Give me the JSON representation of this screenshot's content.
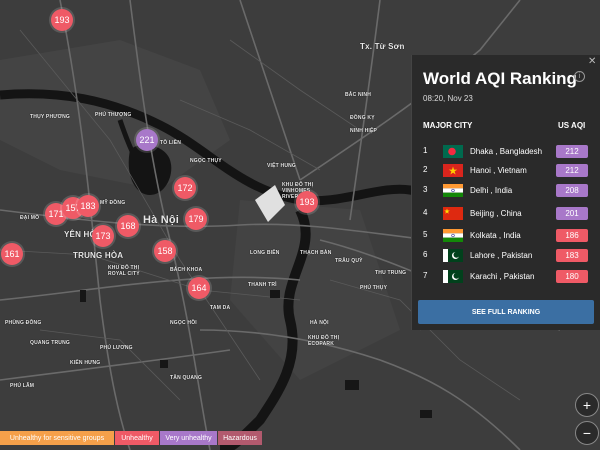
{
  "map": {
    "labels": {
      "hanoi": "Hà Nội",
      "yen_hoa": "YÊN HÒA",
      "trung_hoa": "TRUNG HÒA",
      "tx_tu_son": "Tx. Từ Sơn",
      "bac_ninh": "BẮC NINH",
      "thuy_phuong": "THỤY PHƯƠNG",
      "phu_thuong": "PHÚ THƯỢNG",
      "to_lien": "TÔ LIỀN",
      "ngoc_thuy": "NGỌC THỤY",
      "viet_hung": "VIỆT HUNG",
      "khu_do_thi_vinhomes": "KHU ĐÔ THỊ VINHOMES RIVERSIDE",
      "khu_do_thi_royal": "KHU ĐÔ THỊ ROYAL CITY",
      "bach_khoa": "BÁCH KHOA",
      "thanh_tri": "THANH TRÌ",
      "ha_noi_small": "HÀ NỘI",
      "khu_do_thi_ecopark": "KHU ĐÔ THỊ ECOPARK",
      "phung_dong": "PHÙNG ĐÔNG",
      "quang_trung": "QUANG TRUNG",
      "dai_mo": "ĐẠI MỖ",
      "kien_hung": "KIẾN HƯNG",
      "phu_lam": "PHÚ LÃM",
      "phu_luong": "PHÚ LƯƠNG",
      "tan_quang": "TÂN QUANG",
      "my_dong": "MỸ ĐỒNG",
      "long_bien": "LONG BIÊN",
      "tam_da": "TAM DA",
      "ngoc_hoi": "NGỌC HỒI",
      "thach_ban": "THẠCH BÀN",
      "phu_thuy": "PHÚ THỤY",
      "trau_quy": "TRÂU QUỲ",
      "thu_trung": "THU TRUNG",
      "ninh_hiep": "NINH HIỆP",
      "dong_ky": "ĐỒNG KỴ"
    },
    "markers": [
      "193",
      "221",
      "172",
      "171",
      "157",
      "183",
      "168",
      "179",
      "193",
      "161",
      "173",
      "158",
      "164"
    ]
  },
  "panel": {
    "title": "World AQI Ranking",
    "date": "08:20, Nov 23",
    "col_city": "MAJOR CITY",
    "col_aqi": "US AQI",
    "rows": [
      {
        "rank": "1",
        "city": "Dhaka , Bangladesh",
        "aqi": "212",
        "level": "purple",
        "flag": "bangladesh-flag"
      },
      {
        "rank": "2",
        "city": "Hanoi , Vietnam",
        "aqi": "212",
        "level": "purple",
        "flag": "vietnam-flag"
      },
      {
        "rank": "3",
        "city": "Delhi , India",
        "aqi": "208",
        "level": "purple",
        "flag": "india-flag"
      },
      {
        "rank": "4",
        "city": "Beijing , China",
        "aqi": "201",
        "level": "purple",
        "flag": "china-flag"
      },
      {
        "rank": "5",
        "city": "Kolkata , India",
        "aqi": "186",
        "level": "red",
        "flag": "india-flag"
      },
      {
        "rank": "6",
        "city": "Lahore , Pakistan",
        "aqi": "183",
        "level": "red",
        "flag": "pakistan-flag"
      },
      {
        "rank": "7",
        "city": "Karachi , Pakistan",
        "aqi": "180",
        "level": "red",
        "flag": "pakistan-flag"
      }
    ],
    "button": "SEE FULL RANKING"
  },
  "zoom": {
    "in": "+",
    "out": "−"
  },
  "legend": [
    {
      "label": "Unhealthy for sensitive groups",
      "color": "#f5a04a"
    },
    {
      "label": "Unhealthy",
      "color": "#ef5a66"
    },
    {
      "label": "Very unhealthy",
      "color": "#a878c9"
    },
    {
      "label": "Hazardous",
      "color": "#b25a6e"
    }
  ],
  "colors": {
    "purple": "#a878c9",
    "red": "#ef5a66",
    "button": "#3b6fa3"
  }
}
